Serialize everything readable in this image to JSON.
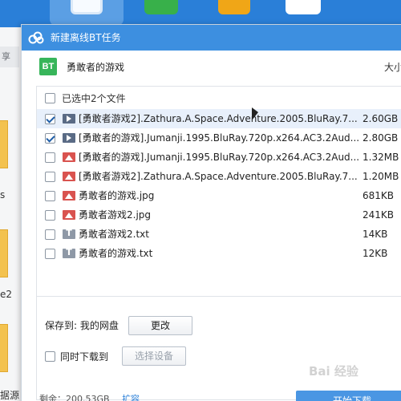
{
  "background": {
    "left_tab": "享",
    "fragments": [
      "s",
      "e2",
      "据源"
    ]
  },
  "dialog": {
    "title": "新建离线BT任务",
    "header": {
      "badge": "BT",
      "task_name": "勇敢者的游戏",
      "size_column": "大小"
    },
    "select_all_label": "已选中2个文件",
    "files": [
      {
        "name": "[勇敢者游戏2].Zathura.A.Space.Adventure.2005.BluRay.7...",
        "size": "2.60GB",
        "type": "video",
        "checked": true
      },
      {
        "name": "[勇敢者的游戏].Jumanji.1995.BluRay.720p.x264.AC3.2Aud...",
        "size": "2.80GB",
        "type": "video",
        "checked": true
      },
      {
        "name": "[勇敢者的游戏].Jumanji.1995.BluRay.720p.x264.AC3.2Aud...",
        "size": "1.32MB",
        "type": "image",
        "checked": false
      },
      {
        "name": "[勇敢者游戏2].Zathura.A.Space.Adventure.2005.BluRay.7...",
        "size": "1.20MB",
        "type": "image",
        "checked": false
      },
      {
        "name": "勇敢者的游戏.jpg",
        "size": "681KB",
        "type": "image",
        "checked": false
      },
      {
        "name": "勇敢者游戏2.jpg",
        "size": "241KB",
        "type": "image",
        "checked": false
      },
      {
        "name": "勇敢者游戏2.txt",
        "size": "14KB",
        "type": "text",
        "checked": false
      },
      {
        "name": "勇敢者的游戏.txt",
        "size": "12KB",
        "type": "text",
        "checked": false
      }
    ],
    "save_to_label": "保存到: 我的网盘",
    "change_button": "更改",
    "sync_download_label": "同时下载到",
    "choose_device_button": "选择设备",
    "footer_remaining": "剩余：200.53GB",
    "footer_expand": "扩容",
    "start_button": "开始下载"
  },
  "watermark": "Bai 经验",
  "colors": {
    "title_bar": "#3d8fe0",
    "bt_badge": "#37b55a",
    "highlight_row": "#e8f0fb",
    "start_button": "#4a96e3"
  }
}
